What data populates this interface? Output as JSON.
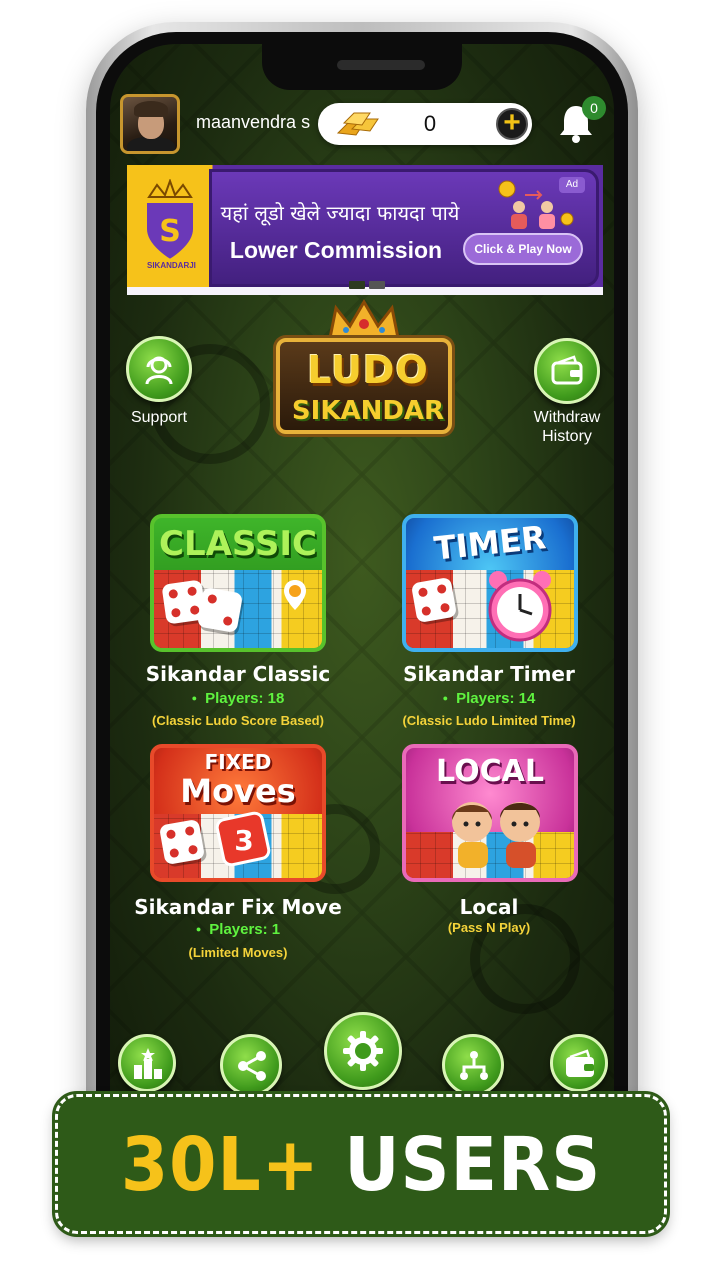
{
  "header": {
    "username": "maanvendra s",
    "coin_balance": "0",
    "add_coins_symbol": "+",
    "notification_count": "0"
  },
  "banner": {
    "brand": "SIKANDARJI",
    "hindi_text": "यहां लूडो खेले ज्यादा फायदा पाये",
    "headline": "Lower Commission",
    "cta": "Click & Play Now",
    "ad_label": "Ad"
  },
  "side_buttons": {
    "support": "Support",
    "withdraw_history_line1": "Withdraw",
    "withdraw_history_line2": "History"
  },
  "logo": {
    "line1": "LUDO",
    "line2": "SIKANDAR"
  },
  "games": [
    {
      "card_title": "CLASSIC",
      "name": "Sikandar Classic",
      "players": "Players: 18",
      "description": "(Classic Ludo Score Based)"
    },
    {
      "card_title": "TIMER",
      "name": "Sikandar Timer",
      "players": "Players: 14",
      "description": "(Classic Ludo Limited Time)"
    },
    {
      "card_title_line1": "FIXED",
      "card_title_line2": "Moves",
      "name": "Sikandar Fix Move",
      "players": "Players: 1",
      "description": "(Limited Moves)"
    },
    {
      "card_title": "LOCAL",
      "name": "Local",
      "description": "(Pass N Play)"
    }
  ],
  "bottom_nav": {
    "icons": [
      "leaderboard-icon",
      "share-icon",
      "settings-icon",
      "referral-network-icon",
      "wallet-icon"
    ]
  },
  "promo": {
    "number": "30L+",
    "word": "USERS"
  },
  "colors": {
    "accent_green": "#3f9a1c",
    "gold": "#f6c21a",
    "promo_bg": "#2e5a18",
    "players_green": "#5ff33f",
    "desc_yellow": "#f4d33a",
    "banner_purple": "#5a2ca0"
  }
}
